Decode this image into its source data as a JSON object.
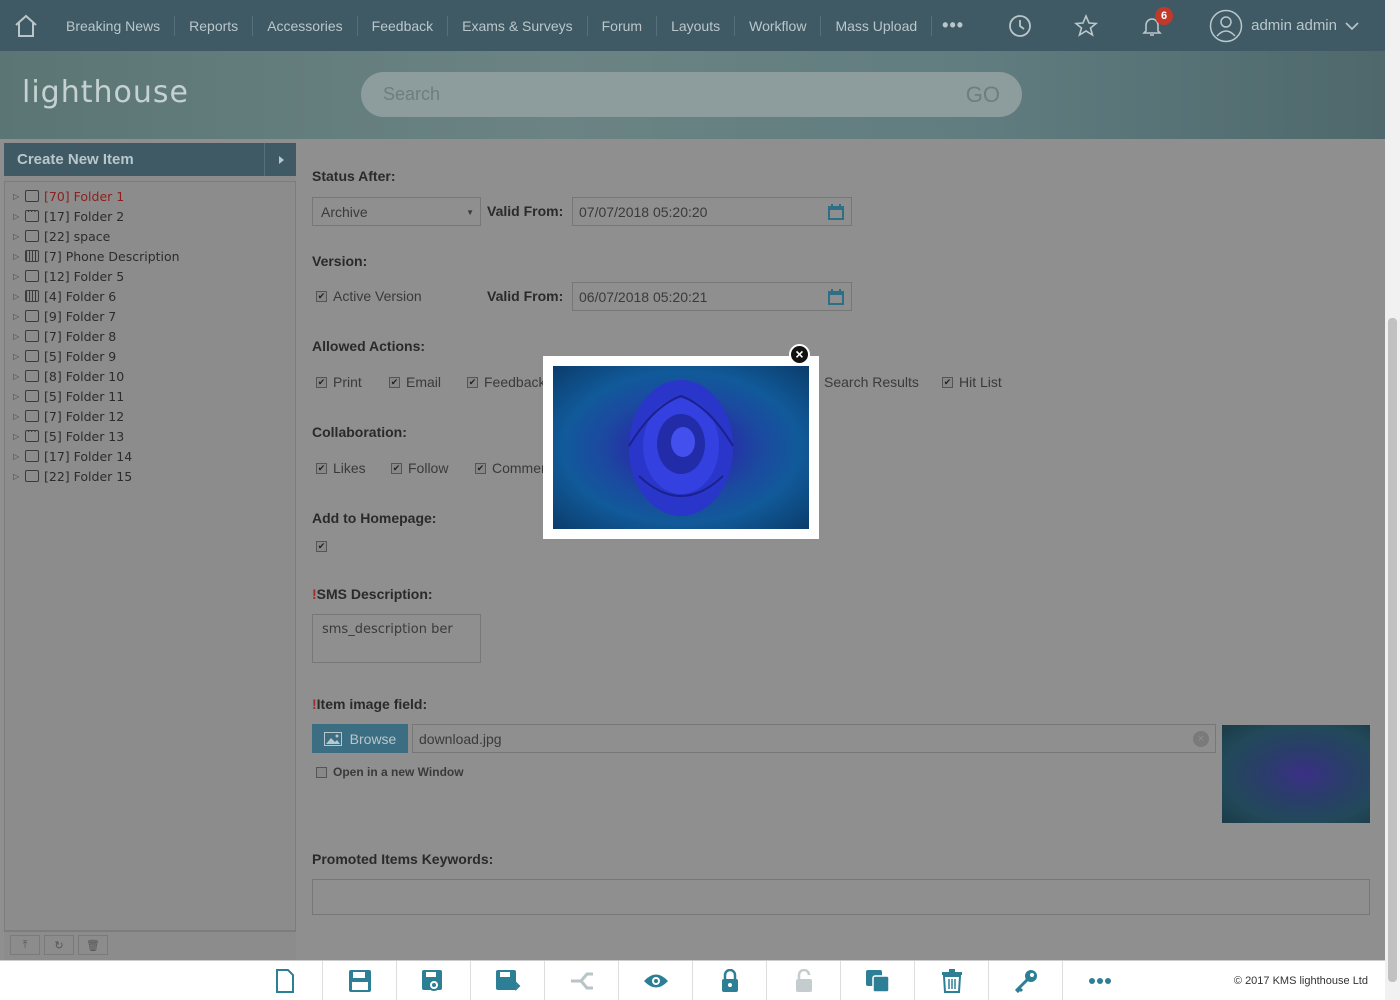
{
  "nav": {
    "items": [
      "Breaking News",
      "Reports",
      "Accessories",
      "Feedback",
      "Exams & Surveys",
      "Forum",
      "Layouts",
      "Workflow",
      "Mass Upload"
    ],
    "more": "•••",
    "notification_count": "6",
    "user_name": "admin admin"
  },
  "header": {
    "logo": "lighthouse",
    "search_placeholder": "Search",
    "go_label": "GO"
  },
  "sidebar": {
    "create_label": "Create New Item",
    "folders": [
      {
        "count": "[70]",
        "name": "Folder 1"
      },
      {
        "count": "[17]",
        "name": "Folder 2"
      },
      {
        "count": "[22]",
        "name": "space"
      },
      {
        "count": "[7]",
        "name": "Phone Description"
      },
      {
        "count": "[12]",
        "name": "Folder 5"
      },
      {
        "count": "[4]",
        "name": "Folder 6"
      },
      {
        "count": "[9]",
        "name": "Folder 7"
      },
      {
        "count": "[7]",
        "name": "Folder 8"
      },
      {
        "count": "[5]",
        "name": "Folder 9"
      },
      {
        "count": "[8]",
        "name": "Folder 10"
      },
      {
        "count": "[5]",
        "name": "Folder 11"
      },
      {
        "count": "[7]",
        "name": "Folder 12"
      },
      {
        "count": "[5]",
        "name": "Folder 13"
      },
      {
        "count": "[17]",
        "name": "Folder 14"
      },
      {
        "count": "[22]",
        "name": "Folder 15"
      }
    ]
  },
  "form": {
    "status_after_label": "Status After:",
    "status_after_value": "Archive",
    "valid_from_label": "Valid From:",
    "status_valid_from": "07/07/2018 05:20:20",
    "version_label": "Version:",
    "active_version_label": "Active Version",
    "version_valid_from": "06/07/2018 05:20:21",
    "allowed_actions_label": "Allowed Actions:",
    "allowed_actions": [
      "Print",
      "Email",
      "Feedback",
      "Search Results",
      "Hit List"
    ],
    "collaboration_label": "Collaboration:",
    "collaboration": [
      "Likes",
      "Follow",
      "Comments"
    ],
    "homepage_label": "Add to Homepage:",
    "sms_label": "SMS Description:",
    "sms_value": "sms_description ber",
    "image_label": "Item image field:",
    "browse_label": "Browse",
    "file_value": "download.jpg",
    "new_window_label": "Open in a new Window",
    "keywords_label": "Promoted Items Keywords:"
  },
  "footer": {
    "copyright": "© 2017 KMS lighthouse Ltd"
  }
}
